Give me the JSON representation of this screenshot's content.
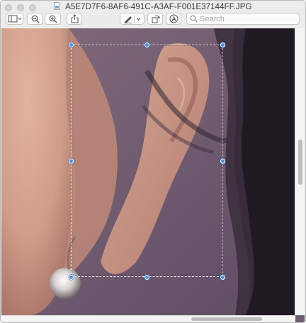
{
  "window": {
    "title": "A5E7D7F6-8AF6-491C-A3AF-F001E37144FF.JPG"
  },
  "toolbar": {
    "sidebar_icon": "sidebar-icon",
    "zoom_out_icon": "zoom-out-icon",
    "zoom_in_icon": "zoom-in-icon",
    "share_icon": "share-icon",
    "markup_icon": "pen-icon",
    "rotate_icon": "rotate-icon",
    "annotate_icon": "markup-circle-icon",
    "search": {
      "placeholder": "Search",
      "value": ""
    }
  },
  "colors": {
    "selection_handle": "#4a90e8",
    "background_purple": "#6f5d70",
    "skin": "#d1a08b"
  }
}
